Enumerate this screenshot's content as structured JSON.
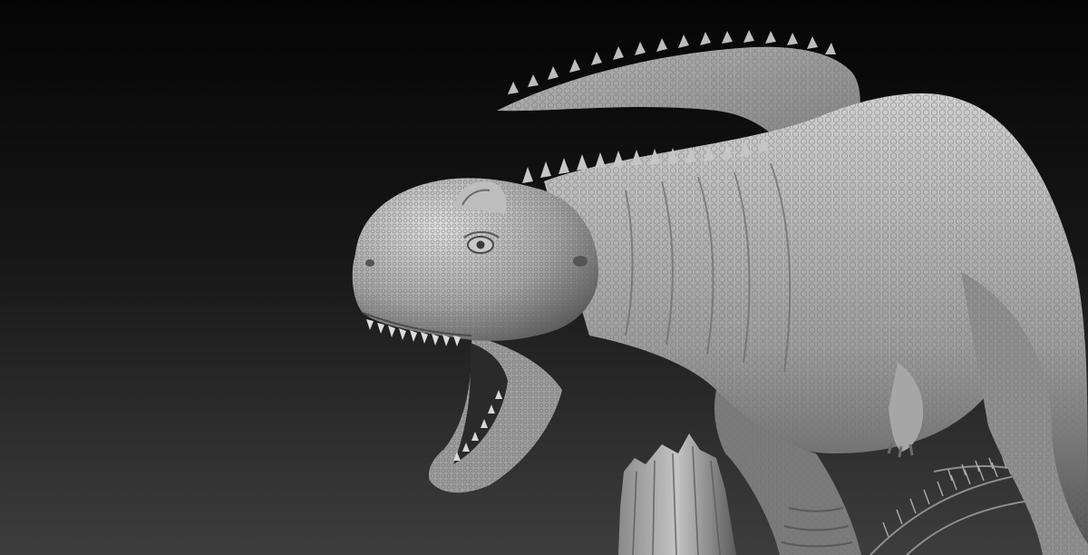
{
  "scene": {
    "subject": "carnotaurus-sculpt",
    "render_style": "grayscale clay render",
    "colors": {
      "background_top": "#050505",
      "background_bottom": "#3d3d3d",
      "clay_light": "#d2d2d2",
      "clay_mid": "#9a9a9a",
      "clay_shadow": "#4a4a4a",
      "mouth_interior": "#2a2a2a"
    }
  }
}
